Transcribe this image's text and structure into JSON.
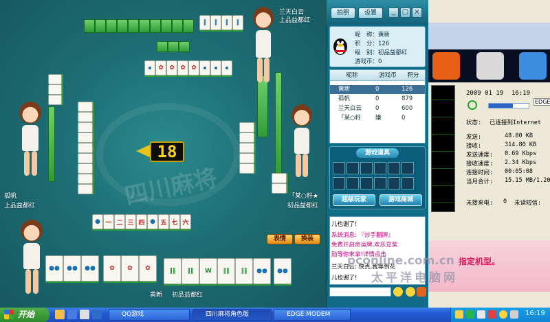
{
  "game": {
    "players": {
      "top": {
        "name": "兰天白云",
        "rank": "上品益都红"
      },
      "right": {
        "name": "「某○籽★",
        "rank": "初品益都红"
      },
      "left": {
        "name": "孤帆",
        "rank": "上品益都红"
      },
      "self": {
        "name": "黄新",
        "rank": "初品益都红"
      }
    },
    "remaining_tiles": "18",
    "buttons": {
      "expression": "表情",
      "costume": "换装"
    }
  },
  "toolbar": {
    "photo": "拍照",
    "settings": "设置",
    "minimize": "_",
    "restore": "▢",
    "close": "×"
  },
  "profile": {
    "nickname_label": "昵　称：",
    "nickname": "黄新",
    "score_label": "积　分：",
    "score": "126",
    "level_label": "级　别：",
    "level": "初品益都红",
    "coins_label": "游戏币：",
    "coins": "0"
  },
  "player_list": {
    "headers": [
      "昵称",
      "游戏币",
      "积分"
    ],
    "rows": [
      {
        "name": "黄新",
        "coins": "0",
        "score": "126",
        "selected": true
      },
      {
        "name": "孤帆",
        "coins": "0",
        "score": "879",
        "selected": false
      },
      {
        "name": "兰天白云",
        "coins": "0",
        "score": "600",
        "selected": false
      },
      {
        "name": "「某○籽",
        "coins": "嫌",
        "score": "0",
        "selected": false
      }
    ]
  },
  "items_panel": {
    "title": "游戏道具",
    "advanced_player": "超级玩家",
    "game_mall": "游戏商城"
  },
  "chat": {
    "lines": [
      {
        "text": "儿也谢了!",
        "color": "#000000"
      },
      {
        "text": "系统消息: 『炒手翻牌』",
        "color": "#c0007a"
      },
      {
        "text": "免费开启命运牌,欢乐豆奖",
        "color": "#c0007a"
      },
      {
        "text": "励等你来拿!详情点击",
        "color": "#c0007a"
      },
      {
        "text": "兰天白云: 快点,我等到花",
        "color": "#000000"
      },
      {
        "text": "儿也谢了!",
        "color": "#000000"
      }
    ]
  },
  "monitor": {
    "date": "2009 01 19",
    "time": "16:19",
    "edge_label": "EDGE",
    "status_label": "状态:",
    "status_value": "已连接到Internet",
    "stats": [
      {
        "label": "发送:",
        "value": "48.80 KB"
      },
      {
        "label": "接收:",
        "value": "314.80 KB"
      },
      {
        "label": "发送速度:",
        "value": "0.69 Kbps"
      },
      {
        "label": "接收速度:",
        "value": "2.34 Kbps"
      },
      {
        "label": "连接时间:",
        "value": "00:05:08"
      },
      {
        "label": "当月合计:",
        "value": "15.15 MB/1.20"
      }
    ],
    "missed_label": "未接来电:",
    "missed_value": "0",
    "unread_label": "未读短信:",
    "ad_text": "指定机型。"
  },
  "watermark": {
    "site": "pconline.com.cn",
    "name": "太平洋电脑网"
  },
  "taskbar": {
    "start": "开始",
    "tasks": [
      "QQ游戏",
      "四川麻将角色版",
      "EDGE MODEM"
    ],
    "clock": "16:19"
  },
  "colors": {
    "table": "#1d6e74",
    "panel": "#0f6b86",
    "taskbar": "#245ad6",
    "start": "#2c8a2a"
  }
}
